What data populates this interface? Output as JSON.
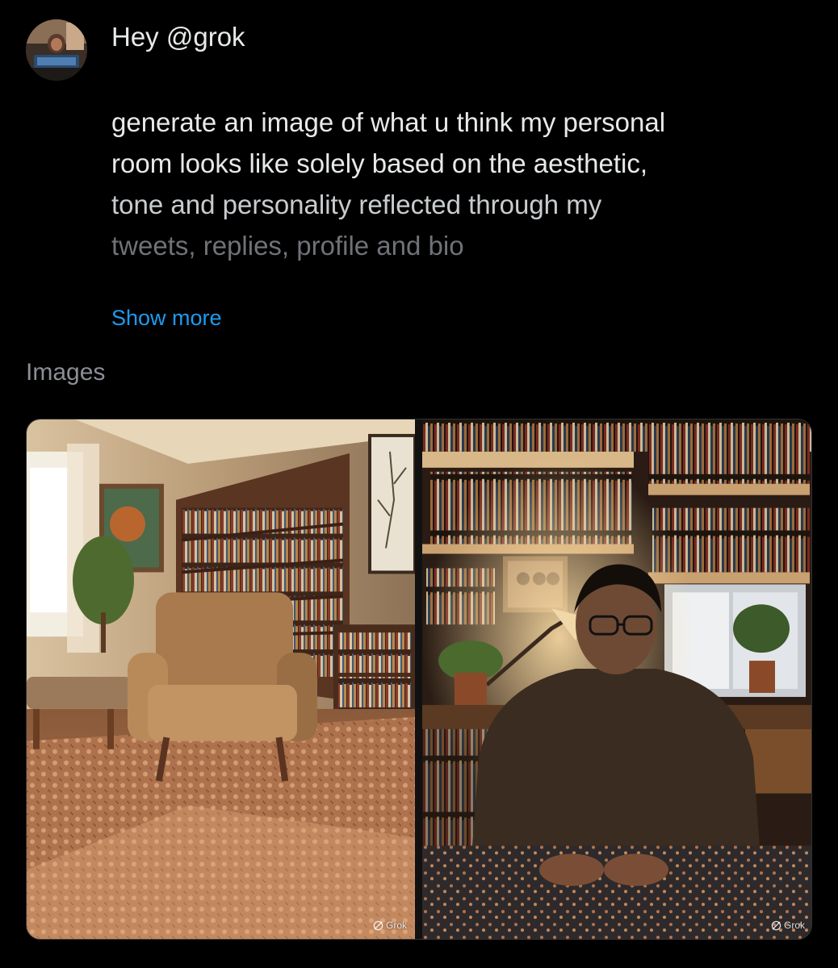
{
  "post": {
    "greeting": "Hey @grok",
    "body_lines": [
      "generate an image of what u think my personal",
      "room looks like solely based on the aesthetic,",
      "tone and personality reflected through my",
      "tweets, replies, profile and bio"
    ],
    "show_more_label": "Show more"
  },
  "images_section": {
    "label": "Images",
    "tiles": [
      {
        "subject": "armchair-room",
        "watermark": "Grok"
      },
      {
        "subject": "person-at-desk",
        "watermark": "Grok"
      }
    ]
  },
  "colors": {
    "background": "#000000",
    "text_primary": "#e7e9ea",
    "text_faded": "#6f7276",
    "link": "#1d9bf0",
    "label_muted": "#8b8f94"
  }
}
